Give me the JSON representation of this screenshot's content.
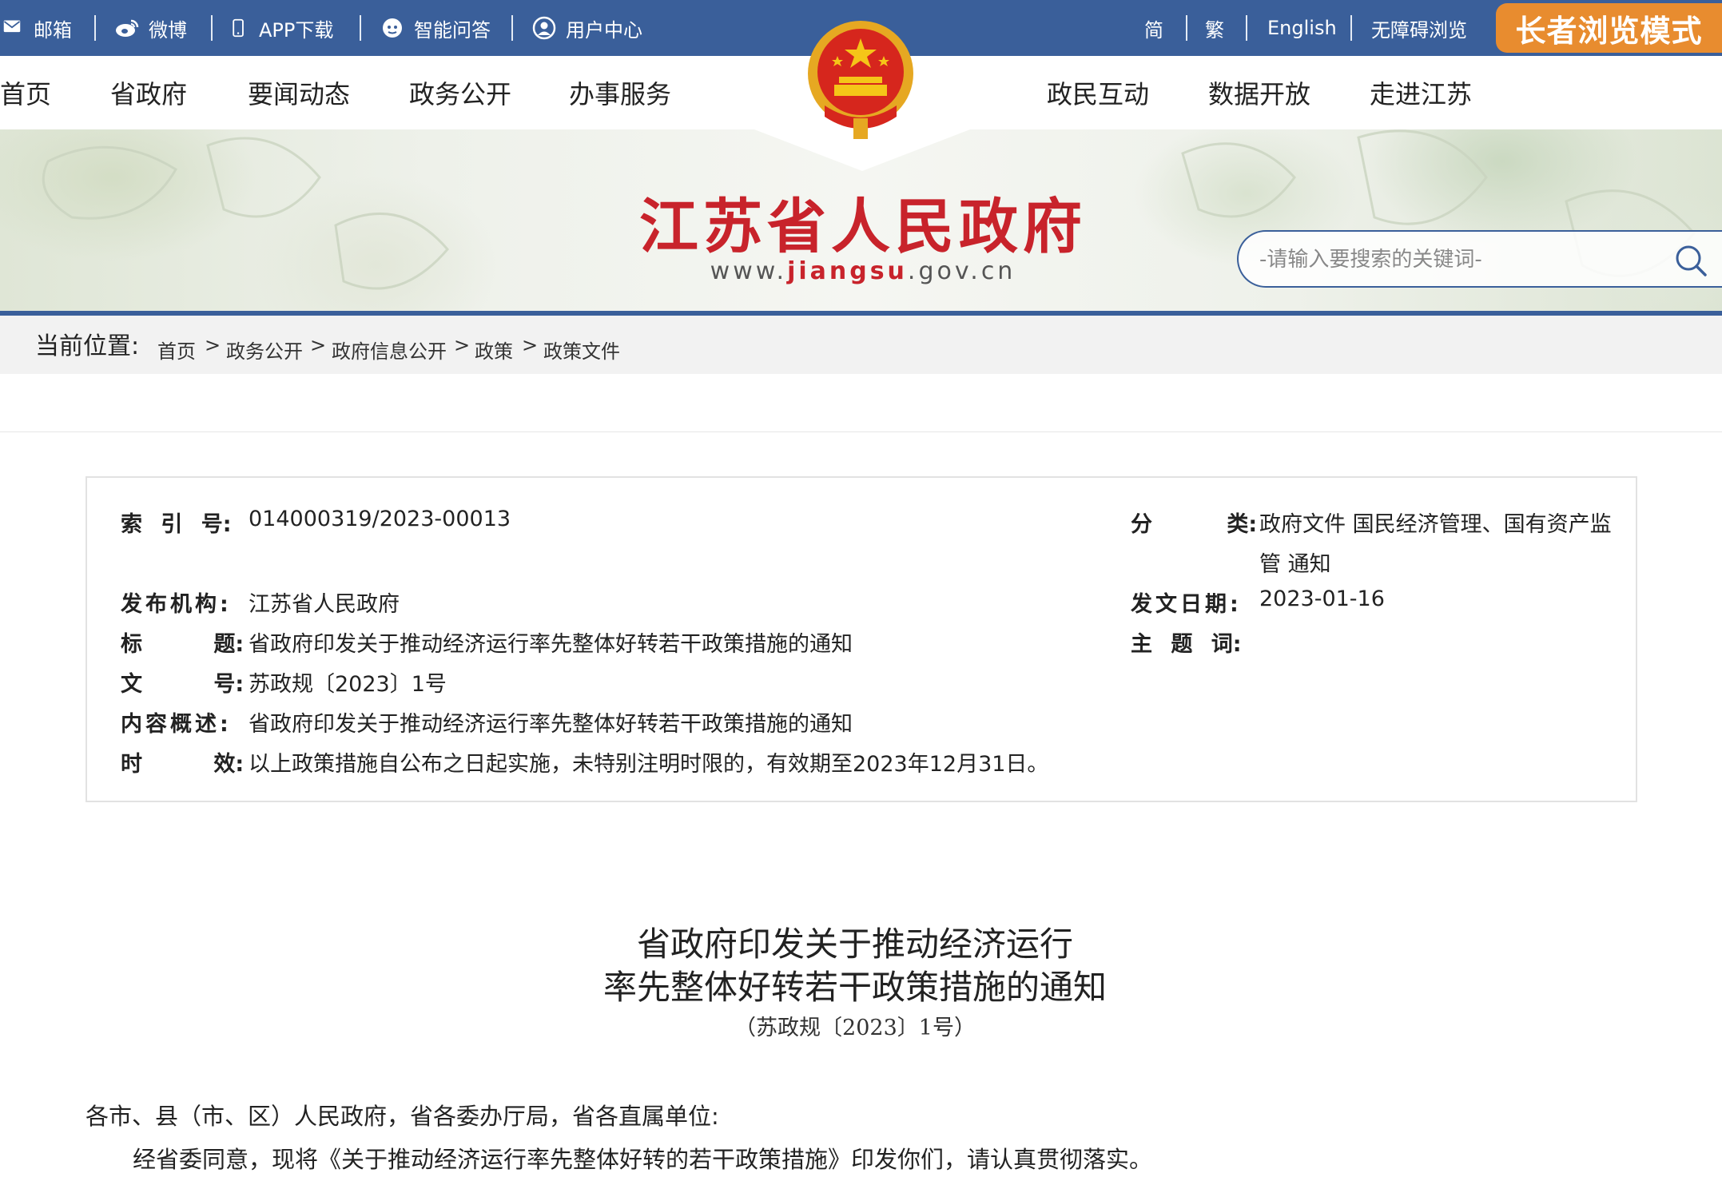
{
  "topbar": {
    "mail": "邮箱",
    "weibo": "微博",
    "app_download": "APP下载",
    "smart_qa": "智能问答",
    "user_center": "用户中心",
    "simplified": "简",
    "traditional": "繁",
    "english": "English",
    "accessible": "无障碍浏览",
    "elder_mode": "长者浏览模式"
  },
  "nav": {
    "left": [
      "首页",
      "省政府",
      "要闻动态",
      "政务公开",
      "办事服务"
    ],
    "right": [
      "政民互动",
      "数据开放",
      "走进江苏"
    ]
  },
  "banner": {
    "site_title": "江苏省人民政府",
    "url_prefix": "www.",
    "url_highlight": "jiangsu",
    "url_suffix": ".gov.cn",
    "search_placeholder": "-请输入要搜索的关键词-"
  },
  "breadcrumb": {
    "label": "当前位置:",
    "items": [
      "首页",
      "政务公开",
      "政府信息公开",
      "政策",
      "政策文件"
    ],
    "separator": ">"
  },
  "info": {
    "index_label": "索 引 号:",
    "index_value": "014000319/2023-00013",
    "category_label": "分 类:",
    "category_value_line1": "政府文件 国民经济管理、国有资产监",
    "category_value_line2": "管 通知",
    "publisher_label": "发布机构:",
    "publisher_value": "江苏省人民政府",
    "date_label": "发文日期:",
    "date_value": "2023-01-16",
    "title_label": "标 题:",
    "title_value": "省政府印发关于推动经济运行率先整体好转若干政策措施的通知",
    "subject_label": "主 题 词:",
    "subject_value": "",
    "docno_label": "文 号:",
    "docno_value": "苏政规〔2023〕1号",
    "summary_label": "内容概述:",
    "summary_value": "省政府印发关于推动经济运行率先整体好转若干政策措施的通知",
    "validity_label": "时 效:",
    "validity_value": "以上政策措施自公布之日起实施，未特别注明时限的，有效期至2023年12月31日。"
  },
  "document": {
    "title_line1": "省政府印发关于推动经济运行",
    "title_line2": "率先整体好转若干政策措施的通知",
    "doc_number": "（苏政规〔2023〕1号）",
    "salutation": "各市、县（市、区）人民政府，省各委办厅局，省各直属单位:",
    "body_line1": "经省委同意，现将《关于推动经济运行率先整体好转的若干政策措施》印发你们，请认真贯彻落实。"
  },
  "colors": {
    "topbar_bg": "#3a5f9a",
    "elder_button": "#e88c2f",
    "site_title": "#c8232b"
  }
}
